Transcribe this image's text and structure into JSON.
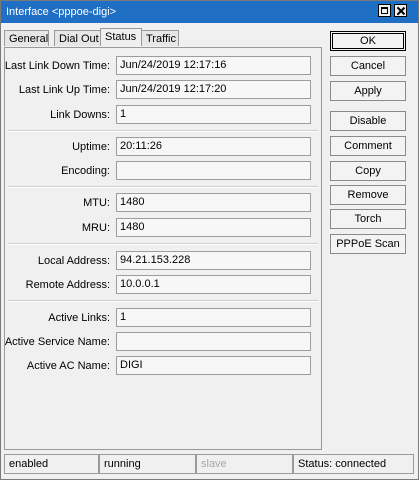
{
  "window": {
    "title": "Interface <pppoe-digi>"
  },
  "tabs": [
    {
      "label": "General"
    },
    {
      "label": "Dial Out"
    },
    {
      "label": "Status",
      "active": true
    },
    {
      "label": "Traffic"
    }
  ],
  "fields": {
    "last_link_down_time": {
      "label": "Last Link Down Time:",
      "value": "Jun/24/2019 12:17:16"
    },
    "last_link_up_time": {
      "label": "Last Link Up Time:",
      "value": "Jun/24/2019 12:17:20"
    },
    "link_downs": {
      "label": "Link Downs:",
      "value": "1"
    },
    "uptime": {
      "label": "Uptime:",
      "value": "20:11:26"
    },
    "encoding": {
      "label": "Encoding:",
      "value": ""
    },
    "mtu": {
      "label": "MTU:",
      "value": "1480"
    },
    "mru": {
      "label": "MRU:",
      "value": "1480"
    },
    "local_address": {
      "label": "Local Address:",
      "value": "94.21.153.228"
    },
    "remote_address": {
      "label": "Remote Address:",
      "value": "10.0.0.1"
    },
    "active_links": {
      "label": "Active Links:",
      "value": "1"
    },
    "active_service_name": {
      "label": "Active Service Name:",
      "value": ""
    },
    "active_ac_name": {
      "label": "Active AC Name:",
      "value": "DIGI"
    }
  },
  "buttons": {
    "ok": "OK",
    "cancel": "Cancel",
    "apply": "Apply",
    "disable": "Disable",
    "comment": "Comment",
    "copy": "Copy",
    "remove": "Remove",
    "torch": "Torch",
    "pppoe_scan": "PPPoE Scan"
  },
  "statusbar": {
    "enabled": "enabled",
    "running": "running",
    "slave": "slave",
    "status": "Status: connected"
  },
  "colors": {
    "titlebar": "#1f6fc5"
  },
  "icons": [
    "maximize-icon",
    "close-icon"
  ]
}
